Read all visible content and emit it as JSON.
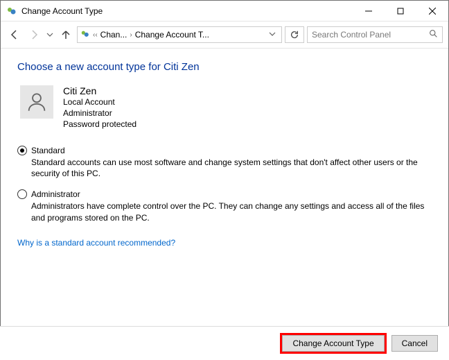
{
  "window": {
    "title": "Change Account Type"
  },
  "breadcrumb": {
    "seg1": "Chan...",
    "seg2": "Change Account T..."
  },
  "search": {
    "placeholder": "Search Control Panel"
  },
  "heading": "Choose a new account type for Citi Zen",
  "account": {
    "name": "Citi Zen",
    "type": "Local Account",
    "role": "Administrator",
    "pwd": "Password protected"
  },
  "options": {
    "standard": {
      "label": "Standard",
      "desc": "Standard accounts can use most software and change system settings that don't affect other users or the security of this PC."
    },
    "admin": {
      "label": "Administrator",
      "desc": "Administrators have complete control over the PC. They can change any settings and access all of the files and programs stored on the PC."
    }
  },
  "link": "Why is a standard account recommended?",
  "buttons": {
    "change": "Change Account Type",
    "cancel": "Cancel"
  }
}
